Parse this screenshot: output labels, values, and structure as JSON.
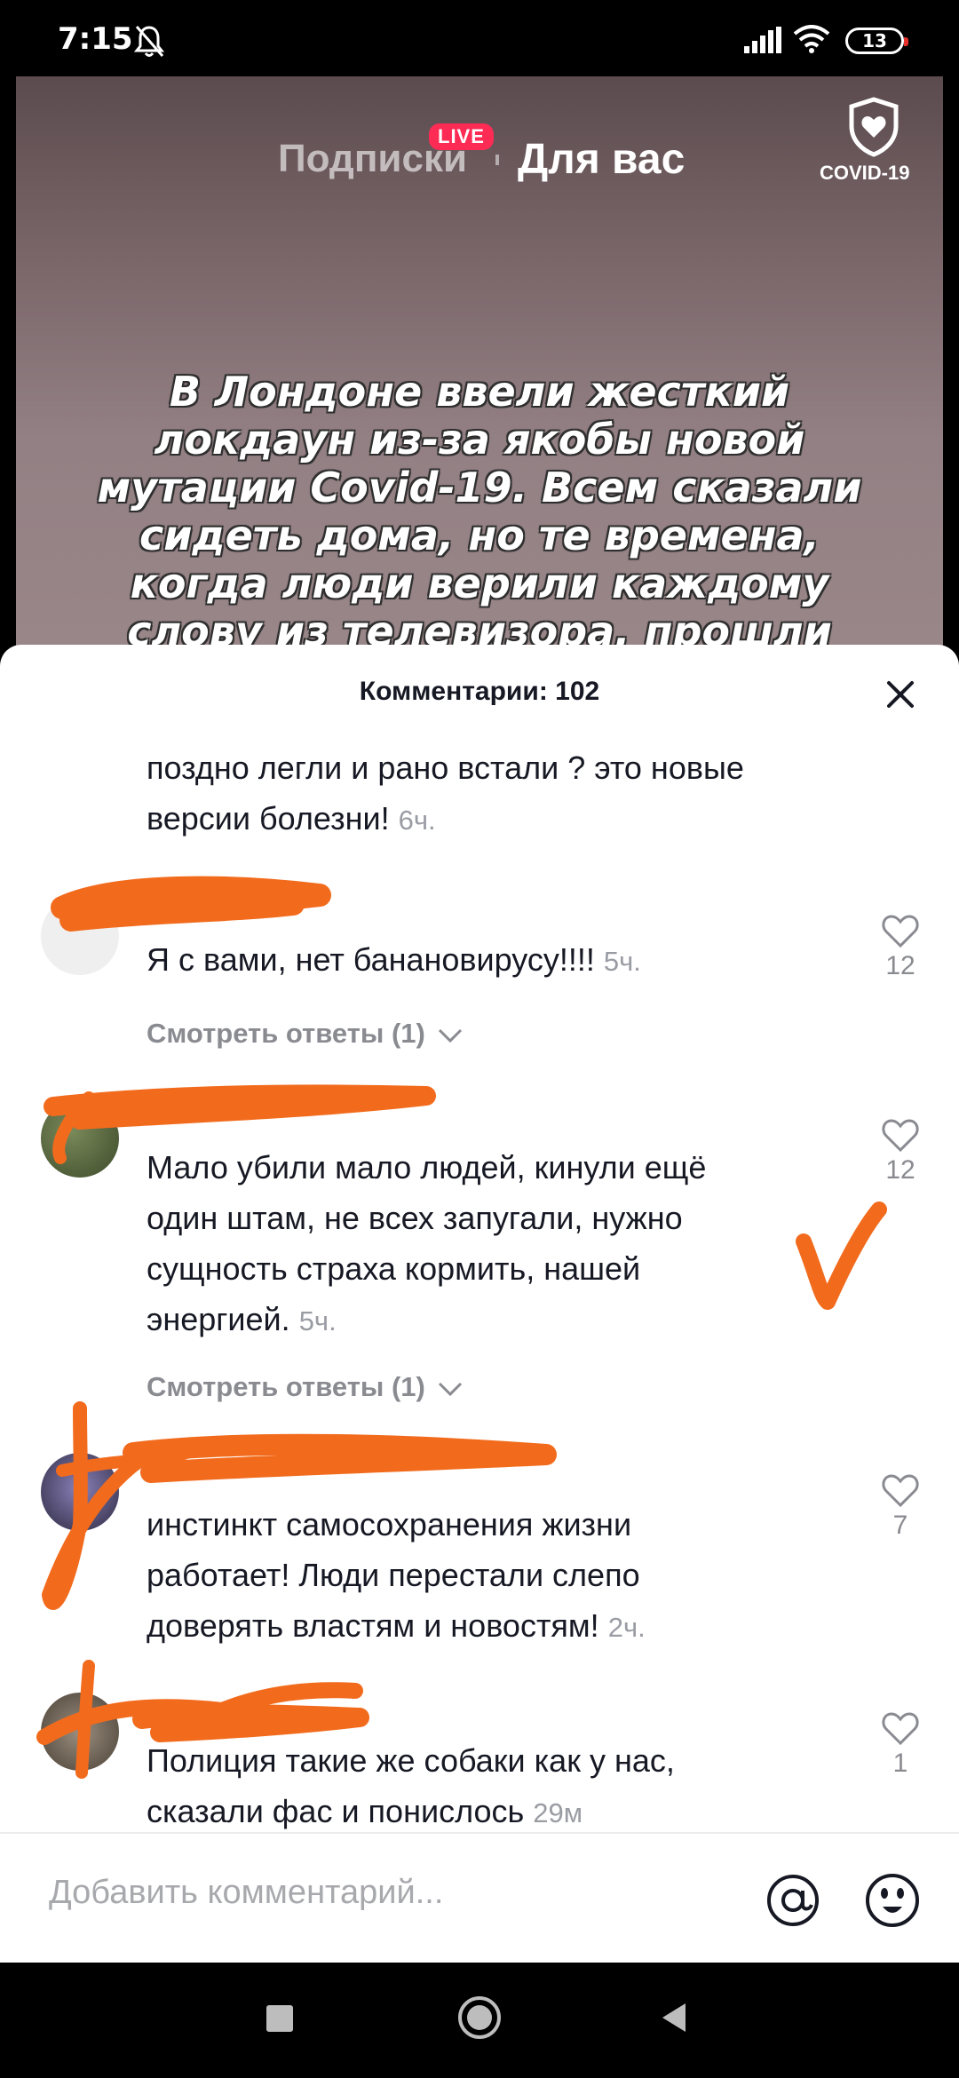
{
  "status_bar": {
    "time": "7:15",
    "battery": "13"
  },
  "top_tabs": {
    "following": "Подписки",
    "live_badge": "LIVE",
    "for_you": "Для вас",
    "covid_label": "COVID-19"
  },
  "video": {
    "caption_lines": [
      "В Лондоне ввели жесткий",
      "локдаун из-за якобы новой",
      "мутации Covid-19. Всем сказали",
      "сидеть дома, но те времена,",
      "когда люди верили каждому",
      "слову из телевизора, прошли"
    ]
  },
  "comments_sheet": {
    "title": "Комментарии: 102",
    "view_replies_label": "Смотреть ответы (1)",
    "comments": [
      {
        "lines": [
          "поздно легли и рано встали ? это новые",
          "версии болезни!"
        ],
        "time": "6ч."
      },
      {
        "lines": [
          "Я с вами, нет банановирусу!!!!"
        ],
        "time": "5ч.",
        "likes": "12"
      },
      {
        "lines": [
          "Мало убили мало людей, кинули ещё",
          "один штам, не всех запугали, нужно",
          "сущность страха кормить, нашей",
          "энергией."
        ],
        "time": "5ч.",
        "likes": "12"
      },
      {
        "lines": [
          "инстинкт самосохранения жизни",
          "работает! Люди перестали слепо",
          "доверять властям и новостям!"
        ],
        "time": "2ч.",
        "likes": "7"
      },
      {
        "lines": [
          "Полиция такие же собаки как у нас,",
          "сказали фас и понислось"
        ],
        "time": "29м",
        "likes": "1"
      }
    ]
  },
  "input_bar": {
    "placeholder": "Добавить комментарий..."
  },
  "colors": {
    "accent_live": "#fe2c55",
    "scribble": "#f26b1d"
  }
}
